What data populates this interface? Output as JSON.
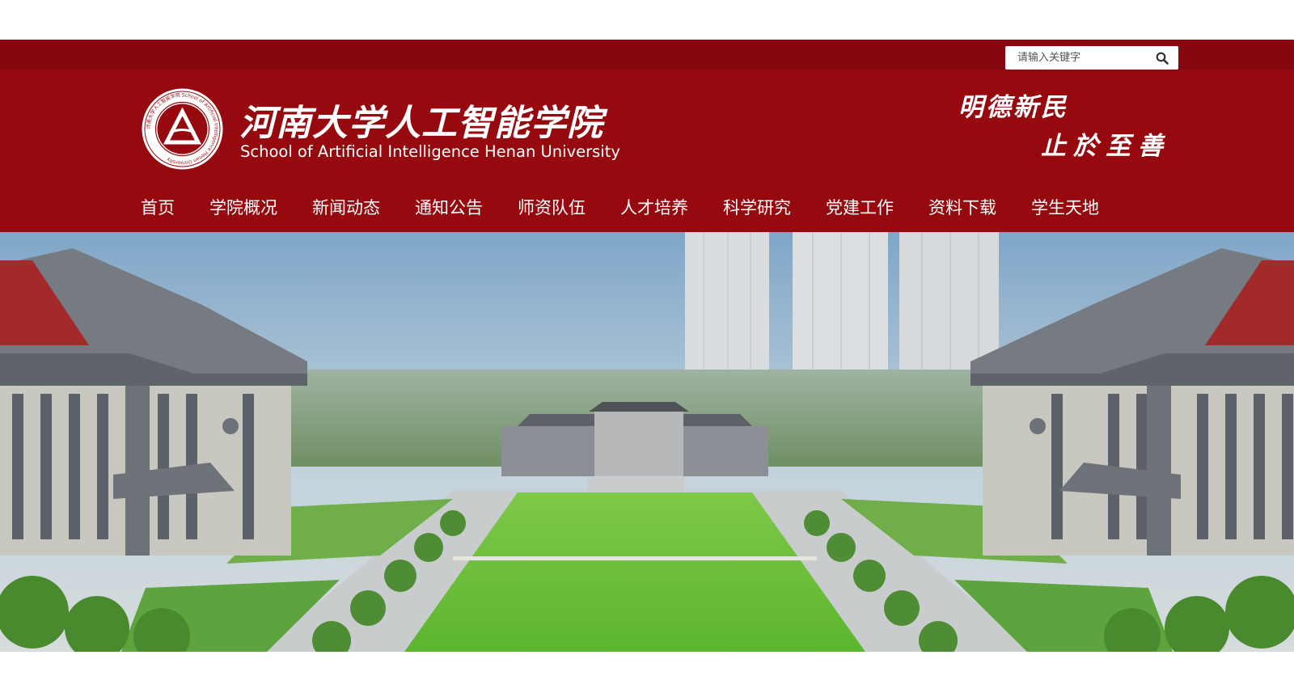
{
  "search": {
    "placeholder": "请输入关键字",
    "icon": "search-icon"
  },
  "header": {
    "title_cn": "河南大学人工智能学院",
    "title_en": "School of Artificial Intelligence Henan University",
    "logo": {
      "icon": "school-seal-logo",
      "ring_text": "河南大学人工智能学院 School of Artificial Intelligence Henan University"
    },
    "motto_line1": "明德新民",
    "motto_line2": "止於至善"
  },
  "nav": {
    "items": [
      {
        "label": "首页"
      },
      {
        "label": "学院概况"
      },
      {
        "label": "新闻动态"
      },
      {
        "label": "通知公告"
      },
      {
        "label": "师资队伍"
      },
      {
        "label": "人才培养"
      },
      {
        "label": "科学研究"
      },
      {
        "label": "党建工作"
      },
      {
        "label": "资料下载"
      },
      {
        "label": "学生天地"
      }
    ]
  },
  "banner": {
    "image": "campus-photo"
  },
  "colors": {
    "topbar": "#860710",
    "header": "#95090f",
    "text": "#ffffff"
  }
}
